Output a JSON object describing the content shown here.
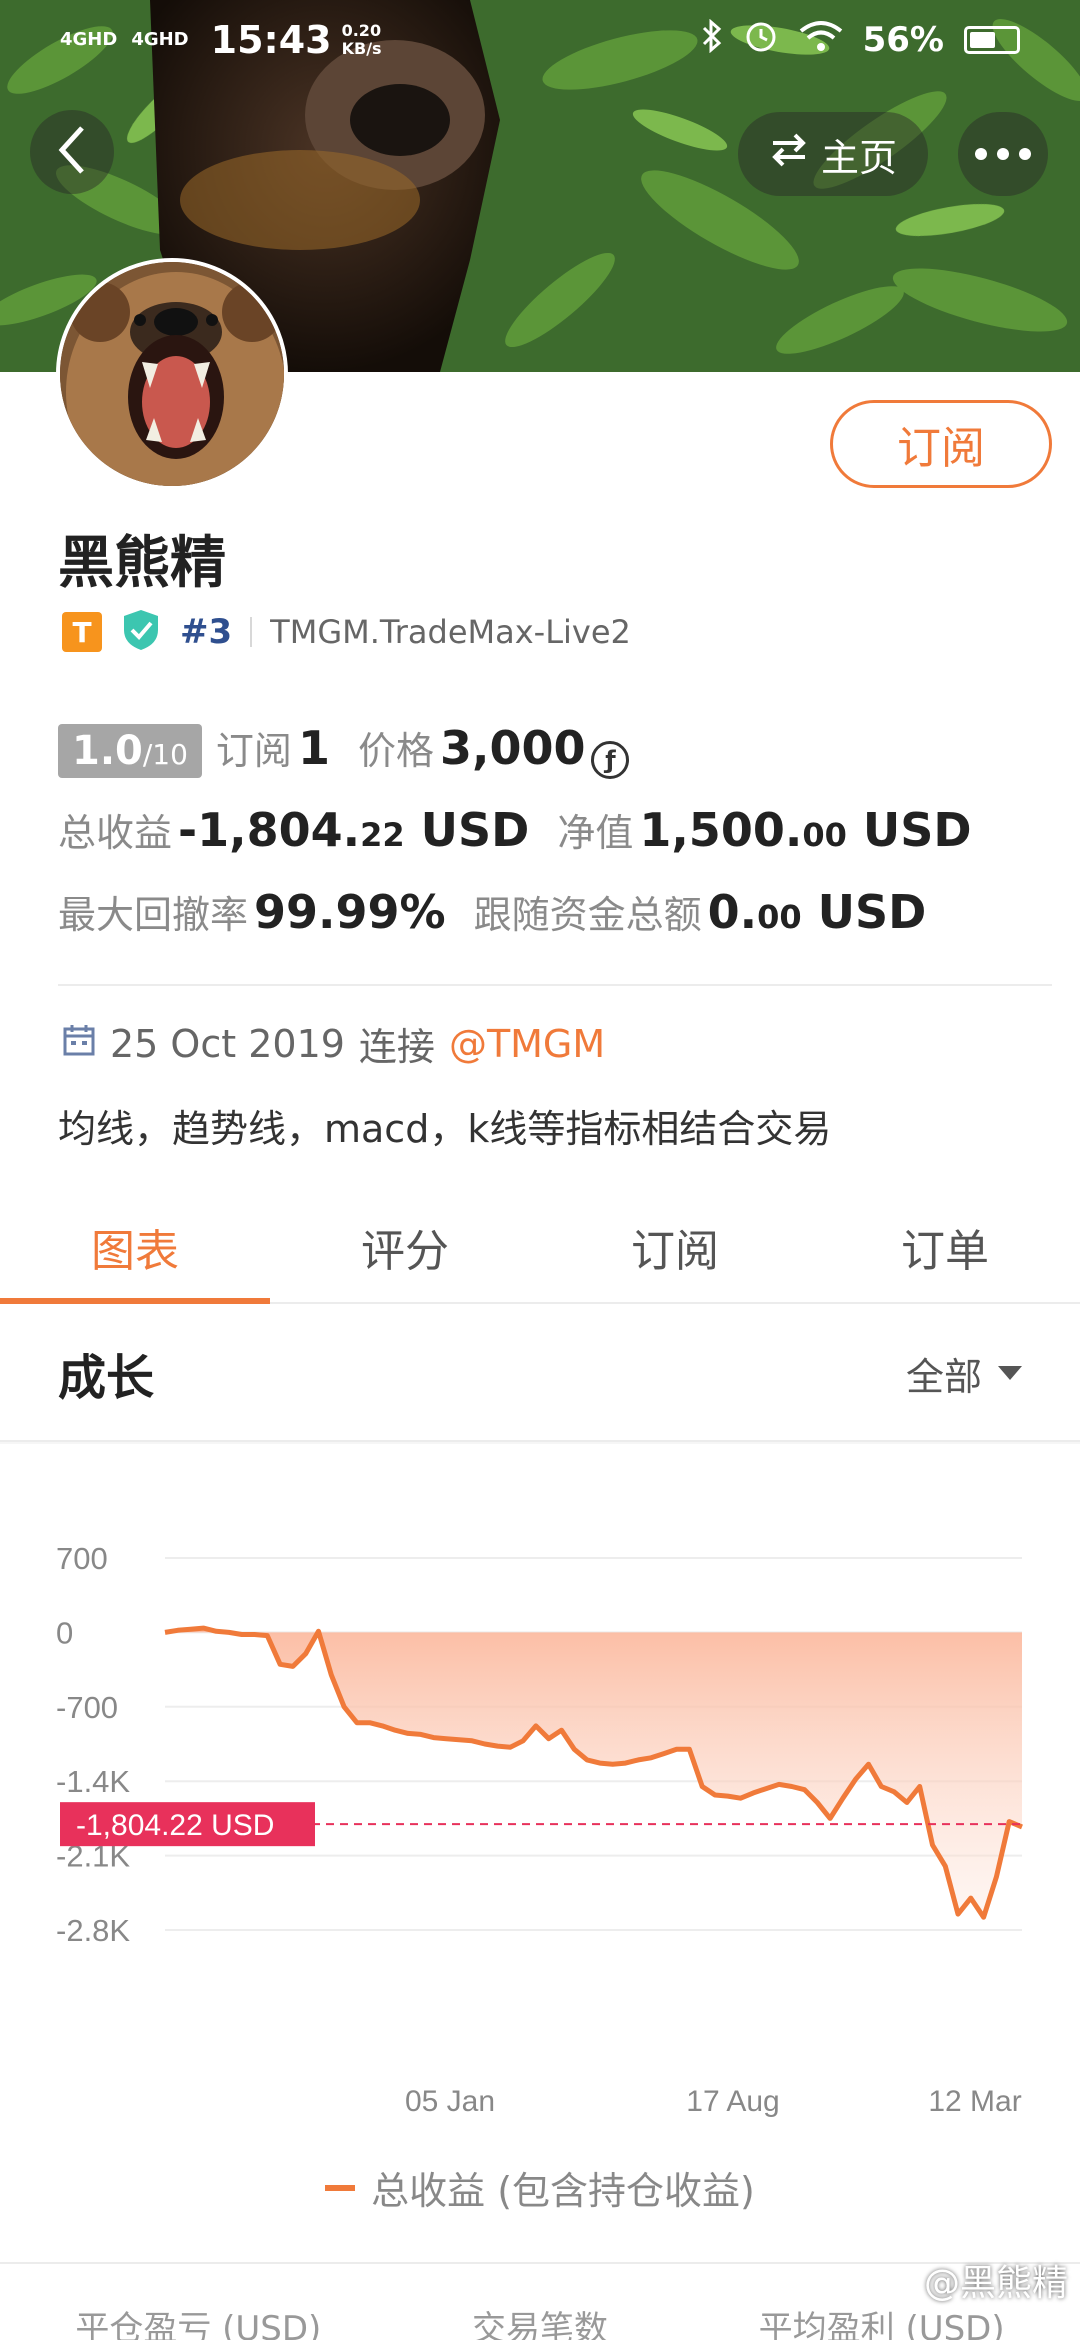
{
  "status_bar": {
    "signal_left": "4GHD",
    "signal_right": "4GHD",
    "time": "15:43",
    "net_speed_value": "0.20",
    "net_speed_unit": "KB/s",
    "battery": "56%",
    "battery_level": 0.56
  },
  "nav": {
    "home_label": "主页"
  },
  "profile": {
    "name": "黑熊精",
    "subscribe_label": "订阅",
    "badge_letter": "T",
    "rank": "#3",
    "broker": "TMGM.TradeMax-Live2"
  },
  "stats": {
    "score": "1.0",
    "score_max": "/10",
    "subscribe_label": "订阅",
    "subscribers": "1",
    "price_label": "价格",
    "price": "3,000",
    "coin_symbol": "ƒ",
    "total_profit_label": "总收益",
    "total_profit_main": "-1,804.",
    "total_profit_dec": "22",
    "total_profit_unit": "USD",
    "equity_label": "净值",
    "equity_main": "1,500.",
    "equity_dec": "00",
    "equity_unit": "USD",
    "max_drawdown_label": "最大回撤率",
    "max_drawdown": "99.99%",
    "follow_funds_label": "跟随资金总额",
    "follow_funds_main": "0.",
    "follow_funds_dec": "00",
    "follow_funds_unit": "USD"
  },
  "joined": {
    "date": "25 Oct 2019",
    "connect_label": "连接",
    "broker_handle": "@TMGM"
  },
  "description": "均线，趋势线，macd，k线等指标相结合交易",
  "tabs": [
    "图表",
    "评分",
    "订阅",
    "订单"
  ],
  "growth": {
    "title": "成长",
    "filter": "全部"
  },
  "chart_data": {
    "type": "area",
    "y_ticks": [
      "700",
      "0",
      "-700",
      "-1.4K",
      "-2.1K",
      "-2.8K"
    ],
    "ylim": [
      -2800,
      700
    ],
    "x_ticks": [
      "05 Jan",
      "17 Aug",
      "12 Mar"
    ],
    "current_value_label": "-1,804.22 USD",
    "current_value": -1804.22,
    "legend": "总收益 (包含持仓收益)",
    "accent_color": "#f07a3a",
    "reference_color": "#e8315b",
    "values": [
      0,
      20,
      30,
      40,
      10,
      0,
      -20,
      -20,
      -30,
      -300,
      -320,
      -200,
      10,
      -400,
      -700,
      -850,
      -850,
      -880,
      -920,
      -950,
      -960,
      -990,
      -1000,
      -1010,
      -1020,
      -1050,
      -1070,
      -1080,
      -1020,
      -880,
      -1000,
      -920,
      -1100,
      -1200,
      -1230,
      -1240,
      -1230,
      -1200,
      -1180,
      -1140,
      -1100,
      -1100,
      -1450,
      -1530,
      -1540,
      -1560,
      -1510,
      -1470,
      -1430,
      -1450,
      -1480,
      -1600,
      -1750,
      -1560,
      -1380,
      -1240,
      -1450,
      -1500,
      -1600,
      -1450,
      -2000,
      -2200,
      -2650,
      -2500,
      -2680,
      -2300,
      -1780,
      -1830
    ]
  },
  "bottom_labels": [
    "平仓盈亏 (USD)",
    "交易笔数",
    "平均盈利 (USD)"
  ],
  "watermark": "@黑熊精"
}
